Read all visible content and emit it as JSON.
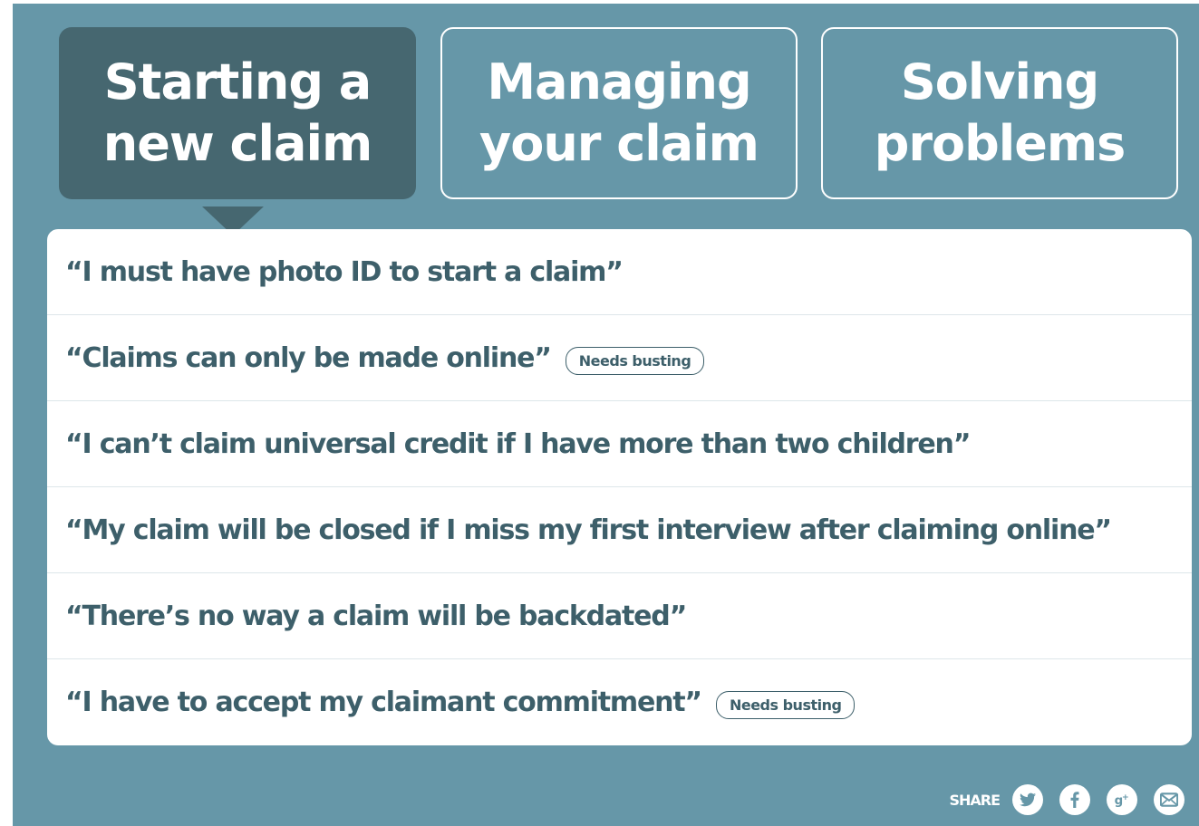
{
  "tabs": [
    {
      "line1": "Starting a",
      "line2": "new claim",
      "active": true
    },
    {
      "line1": "Managing",
      "line2": "your claim",
      "active": false
    },
    {
      "line1": "Solving",
      "line2": "problems",
      "active": false
    }
  ],
  "myths": [
    {
      "text": "“I must have photo ID to start a claim”",
      "badge": ""
    },
    {
      "text": "“Claims can only be made online”",
      "badge": "Needs busting"
    },
    {
      "text": "“I can’t claim universal credit if I have more than two children”",
      "badge": ""
    },
    {
      "text": "“My claim will be closed if I miss my first interview after claiming online”",
      "badge": ""
    },
    {
      "text": "“There’s no way a claim will be backdated”",
      "badge": ""
    },
    {
      "text": "“I have to accept my claimant commitment”",
      "badge": "Needs busting"
    }
  ],
  "share": {
    "label": "SHARE",
    "icons": [
      "twitter-icon",
      "facebook-icon",
      "google-plus-icon",
      "email-icon"
    ]
  },
  "colors": {
    "background": "#6697a8",
    "active_tab": "#466770",
    "text": "#3d5f6a",
    "panel": "#ffffff"
  }
}
